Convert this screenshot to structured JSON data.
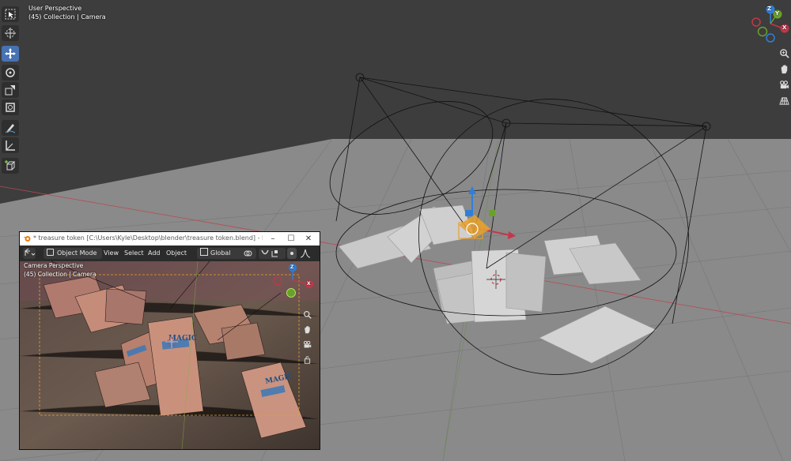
{
  "viewport": {
    "title": "User Perspective",
    "subtitle": "(45) Collection | Camera"
  },
  "toolbar": {
    "tools": [
      "select-box-icon",
      "cursor-icon",
      "move-icon",
      "rotate-icon",
      "scale-icon",
      "transform-icon",
      "annotate-icon",
      "measure-icon",
      "add-cube-icon"
    ],
    "active": "move-icon"
  },
  "nav_gizmo": {
    "y_label": "Y",
    "x_label": "X",
    "z_label": "Z"
  },
  "navigation": [
    "zoom-icon",
    "hand-pan-icon",
    "camera-view-icon",
    "grid-ortho-icon"
  ],
  "render_window": {
    "title": "* treasure token [C:\\Users\\Kyle\\Desktop\\blender\\treasure token.blend] - Blend...",
    "controls": [
      "–",
      "☐",
      "✕"
    ],
    "header": {
      "mode": "Object Mode",
      "menus": [
        "View",
        "Select",
        "Add",
        "Object"
      ],
      "orientation": "Global"
    },
    "viewport": {
      "title": "Camera Perspective",
      "subtitle": "(45) Collection | Camera"
    },
    "gizmo": {
      "z_label": "Z",
      "x_label": "X"
    }
  },
  "colors": {
    "accent_blue": "#4772b3",
    "axis_red": "#c4364a",
    "axis_green": "#6aa12a",
    "axis_blue": "#2f7fd9",
    "selection_orange": "#e8a12d"
  }
}
